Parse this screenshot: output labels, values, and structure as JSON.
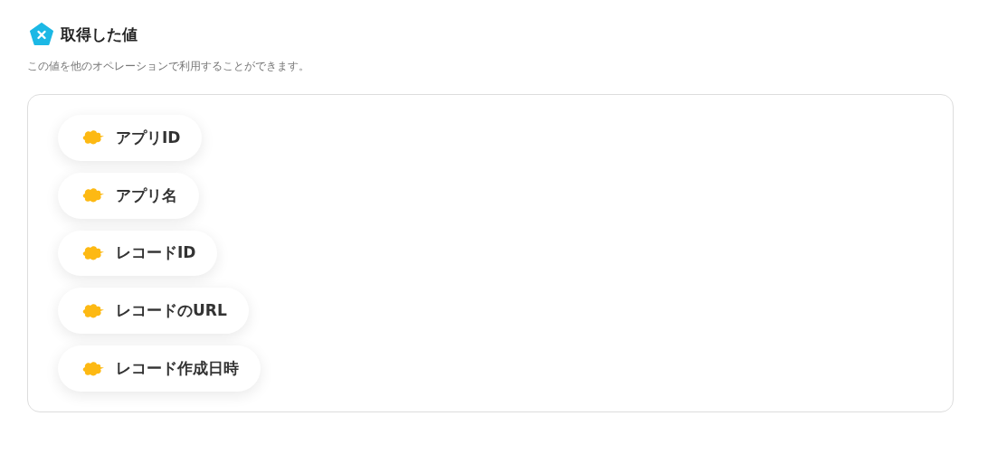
{
  "header": {
    "title": "取得した値",
    "description": "この値を他のオペレーションで利用することができます。"
  },
  "values": [
    {
      "label": "アプリID"
    },
    {
      "label": "アプリ名"
    },
    {
      "label": "レコードID"
    },
    {
      "label": "レコードのURL"
    },
    {
      "label": "レコード作成日時"
    }
  ]
}
